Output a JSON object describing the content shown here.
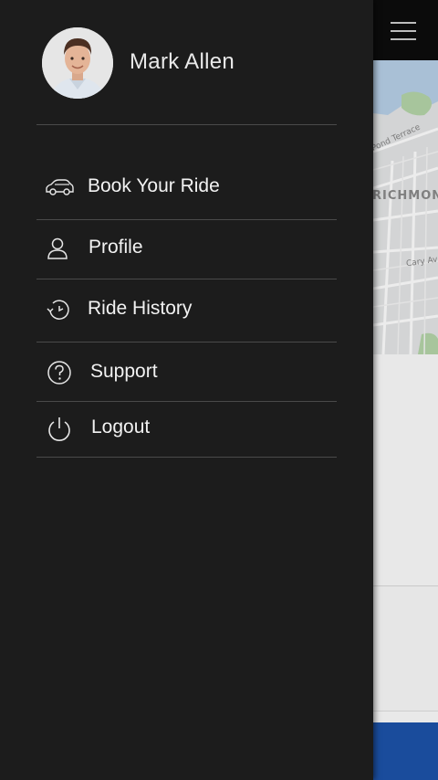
{
  "user": {
    "name": "Mark Allen"
  },
  "menu": {
    "items": [
      {
        "label": "Book Your Ride",
        "icon": "car-icon"
      },
      {
        "label": "Profile",
        "icon": "person-icon"
      },
      {
        "label": "Ride History",
        "icon": "history-icon"
      },
      {
        "label": "Support",
        "icon": "help-circle-icon"
      },
      {
        "label": "Logout",
        "icon": "power-icon"
      }
    ]
  },
  "map": {
    "labels": {
      "neighborhood": "RICHMON",
      "street1": "Pond Terrace",
      "street2": "Cary Av"
    }
  },
  "colors": {
    "drawer_bg": "#1c1c1c",
    "topbar_bg": "#0b0b0b",
    "accent_blue": "#1a4c9c",
    "text_light": "#f2f2f2"
  }
}
